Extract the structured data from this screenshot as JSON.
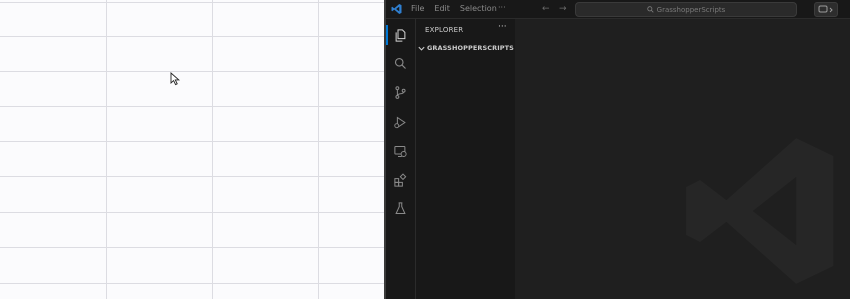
{
  "titlebar": {
    "menu": [
      "File",
      "Edit",
      "Selection"
    ],
    "more": "···",
    "back": "←",
    "forward": "→",
    "search_text": "GrasshopperScripts"
  },
  "activity": [
    "explorer-icon",
    "search-icon",
    "source-control-icon",
    "run-debug-icon",
    "remote-explorer-icon",
    "extensions-icon",
    "testing-icon"
  ],
  "sidebar": {
    "title": "EXPLORER",
    "more": "···",
    "folder": "GRASSHOPPERSCRIPTS"
  },
  "colors": {
    "accent": "#0078d4",
    "bg": "#1f1f1f",
    "sidebar_bg": "#181818",
    "sheet_bg": "#fbfbfd",
    "grid": "#dcdce2"
  }
}
